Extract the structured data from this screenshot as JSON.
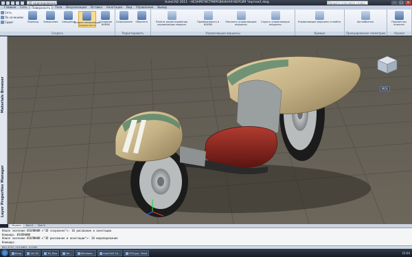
{
  "titlebar": {
    "workspace": "3D моделирование",
    "title": "AutoCAD 2011 - НЕЗАРЕГИСТРИРОВАННАЯ ВЕРСИЯ    Чертеж1.dwg",
    "search_placeholder": "Введите ключевое слово/фразу",
    "minimize": "–",
    "maximize": "□",
    "close": "×"
  },
  "tabs": [
    "Главная",
    "Сеть",
    "Поверхность",
    "Тела",
    "Визуализация",
    "Вставка",
    "Аннотации",
    "Вид",
    "Управление",
    "Вывод"
  ],
  "active_tab": "Поверхность",
  "ribbon": {
    "panels": [
      {
        "title": "Создать",
        "small": [
          "Сеть",
          "По сечениям",
          "Сдвиг"
        ],
        "big": [
          "Переход",
          "Замыкание",
          "Смещение",
          "Аппроксимирующая поверхность",
          "Создание NURBS"
        ]
      },
      {
        "title": "Редактировать",
        "big": [
          "Сопряжение",
          "Обрезать"
        ]
      },
      {
        "title": "Управляющие вершины",
        "big": [
          "Панель редактирования управляющих вершин",
          "Преобразовать в NURBS",
          "Показать управляющие вершины",
          "Скрыть управляющие вершины"
        ]
      },
      {
        "title": "Кривые",
        "big": [
          "Управляющие вершины сплайна"
        ]
      },
      {
        "title": "Проецирование геометрии",
        "big": [
          "Автообрезка"
        ]
      },
      {
        "title": "Анализ",
        "big": [
          "Параметры анализа"
        ]
      }
    ]
  },
  "side_palette": {
    "top": "Materials Browser",
    "bottom": "Layer Properties Manager"
  },
  "viewcube": {
    "wcs": "МСК"
  },
  "layout_tabs": [
    "Модель",
    "Лист1",
    "Лист2"
  ],
  "command_lines": [
    "Новое значение ИЗОЛИНИИ <\"3D сохранено\">: 10 рисование и аннотации",
    "Команда: ИЗОЛИНИИ",
    "Новое значение ИЗОЛИНИИ <\"3D рисование и аннотации\">: 30 моделирование",
    "Команда:"
  ],
  "status_coords": "842.3707, 215.8652, 0.0000",
  "taskbar": {
    "items": [
      "Вход",
      "Vid 3D",
      "3D_files",
      "Ne...",
      "Windows...",
      "AutoCAD 20...",
      "P02.jpg - Paint"
    ],
    "clock": "15:04"
  },
  "colors": {
    "body_shell": "#cbb88a",
    "seat": "#8c1f1a",
    "stripe": "#f2f2ea",
    "trim": "#5f8a6e",
    "tire": "#1b1b1b",
    "wheel": "#b9bcbd"
  }
}
